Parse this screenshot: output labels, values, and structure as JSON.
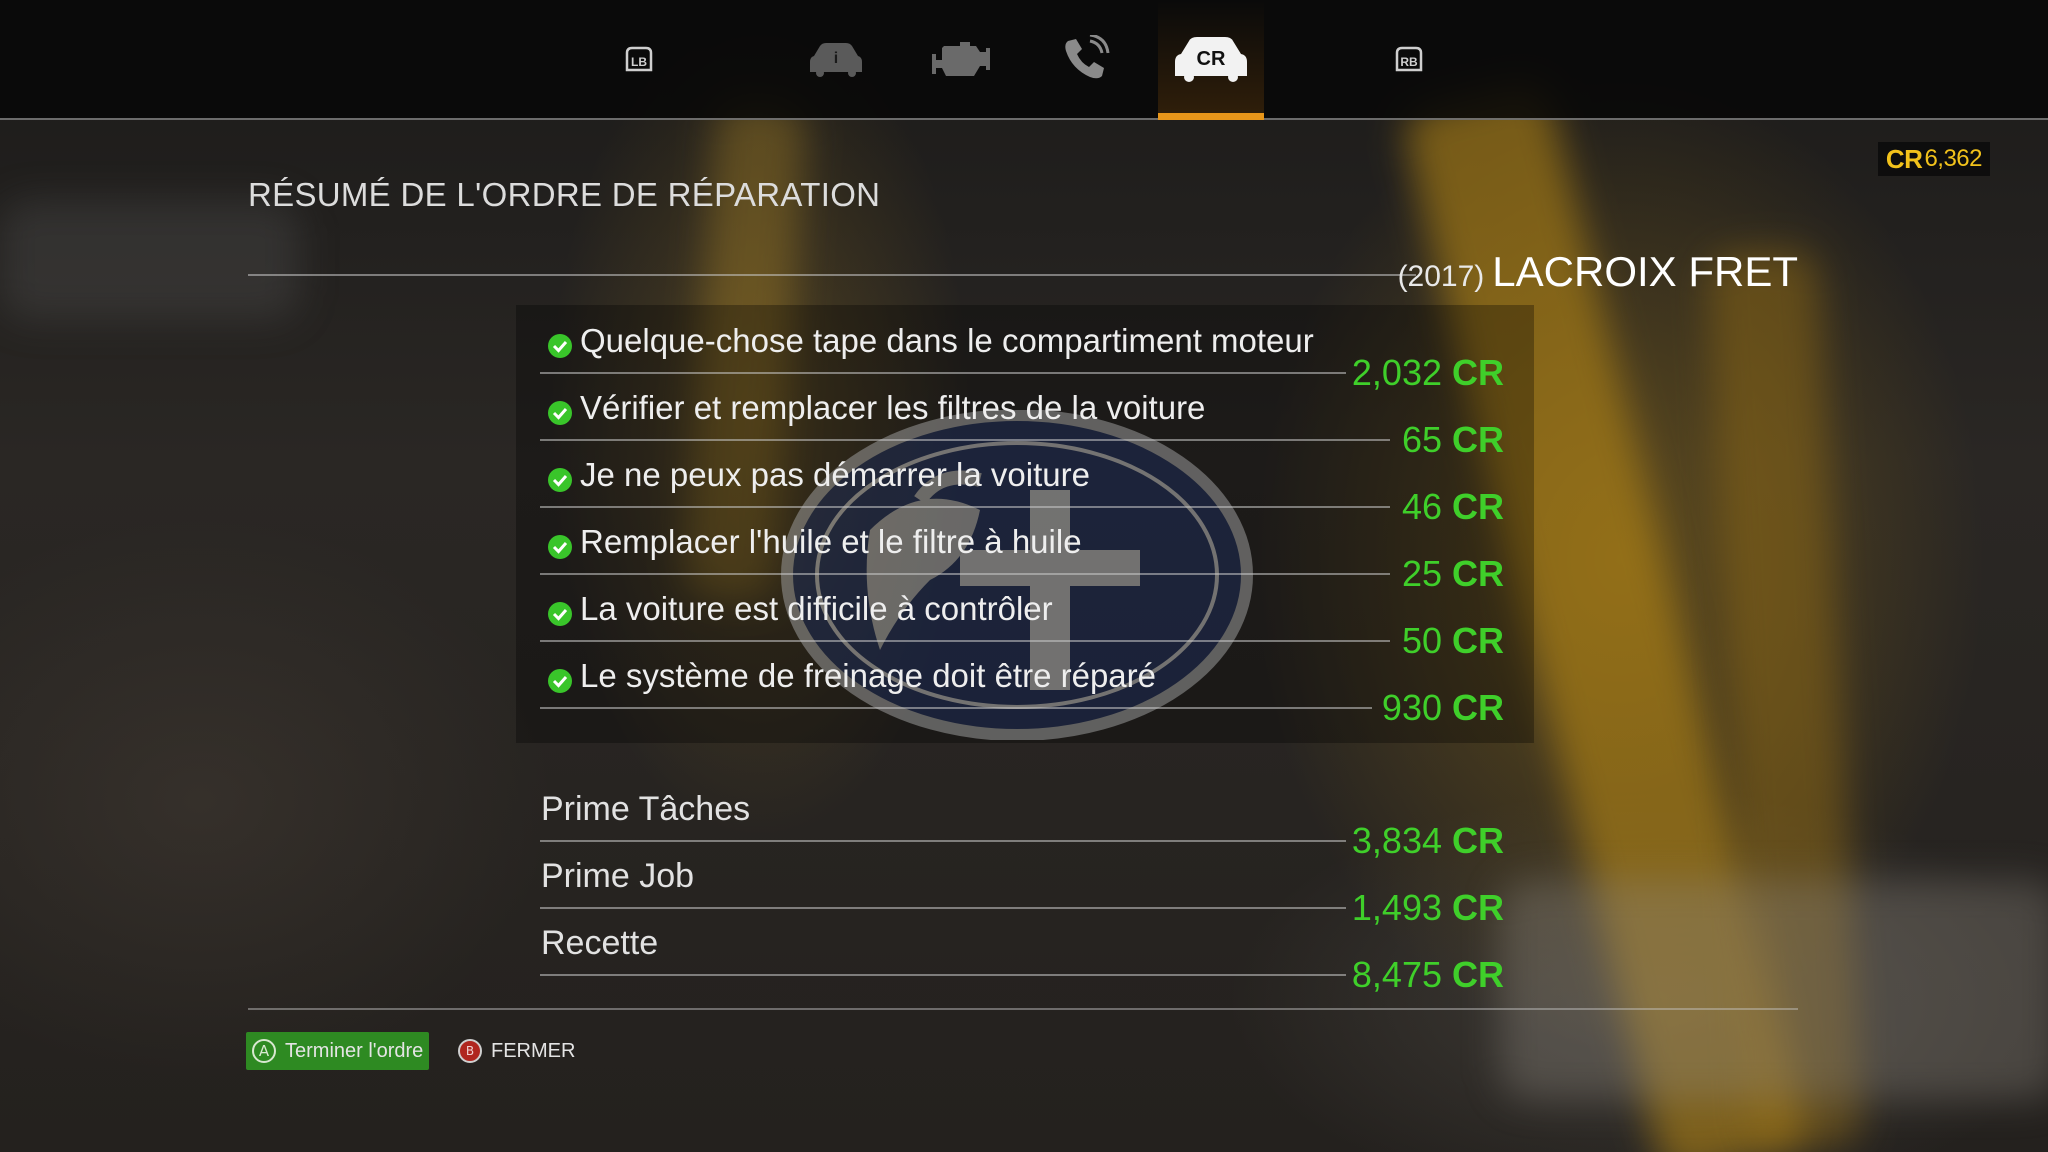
{
  "nav": {
    "tabs": [
      {
        "id": "lb",
        "icon": "lb-bumper-icon",
        "label": "LB"
      },
      {
        "id": "info",
        "icon": "car-info-icon",
        "label": "i"
      },
      {
        "id": "engine",
        "icon": "engine-icon",
        "label": ""
      },
      {
        "id": "phone",
        "icon": "phone-icon",
        "label": ""
      },
      {
        "id": "cr",
        "icon": "car-cr-icon",
        "label": "CR",
        "active": true
      },
      {
        "id": "rb",
        "icon": "rb-bumper-icon",
        "label": "RB"
      }
    ],
    "active_color": "#e8961a"
  },
  "balance": {
    "prefix": "CR",
    "amount": "6,362",
    "color": "#f2c21b"
  },
  "page_title": "RÉSUMÉ DE L'ORDRE DE RÉPARATION",
  "vehicle": {
    "year": "(2017)",
    "name": "LACROIX FRET"
  },
  "tasks": [
    {
      "label": "Quelque-chose tape dans le compartiment moteur",
      "amount": "2,032",
      "unit": "CR",
      "done": true
    },
    {
      "label": "Vérifier et remplacer les filtres de la voiture",
      "amount": "65",
      "unit": "CR",
      "done": true
    },
    {
      "label": "Je ne peux pas démarrer la voiture",
      "amount": "46",
      "unit": "CR",
      "done": true
    },
    {
      "label": "Remplacer l'huile et le filtre à huile",
      "amount": "25",
      "unit": "CR",
      "done": true
    },
    {
      "label": "La voiture est difficile à contrôler",
      "amount": "50",
      "unit": "CR",
      "done": true
    },
    {
      "label": "Le système de freinage doit être réparé",
      "amount": "930",
      "unit": "CR",
      "done": true
    }
  ],
  "summary": [
    {
      "label": "Prime Tâches",
      "amount": "3,834",
      "unit": "CR"
    },
    {
      "label": "Prime Job",
      "amount": "1,493",
      "unit": "CR"
    },
    {
      "label": "Recette",
      "amount": "8,475",
      "unit": "CR"
    }
  ],
  "amount_color": "#3fcf2a",
  "actions": {
    "finish": {
      "glyph": "A",
      "label": "Terminer l'ordre",
      "color": "#2e8a22"
    },
    "close": {
      "glyph": "B",
      "label": "FERMER",
      "color": "#b0261f"
    }
  }
}
